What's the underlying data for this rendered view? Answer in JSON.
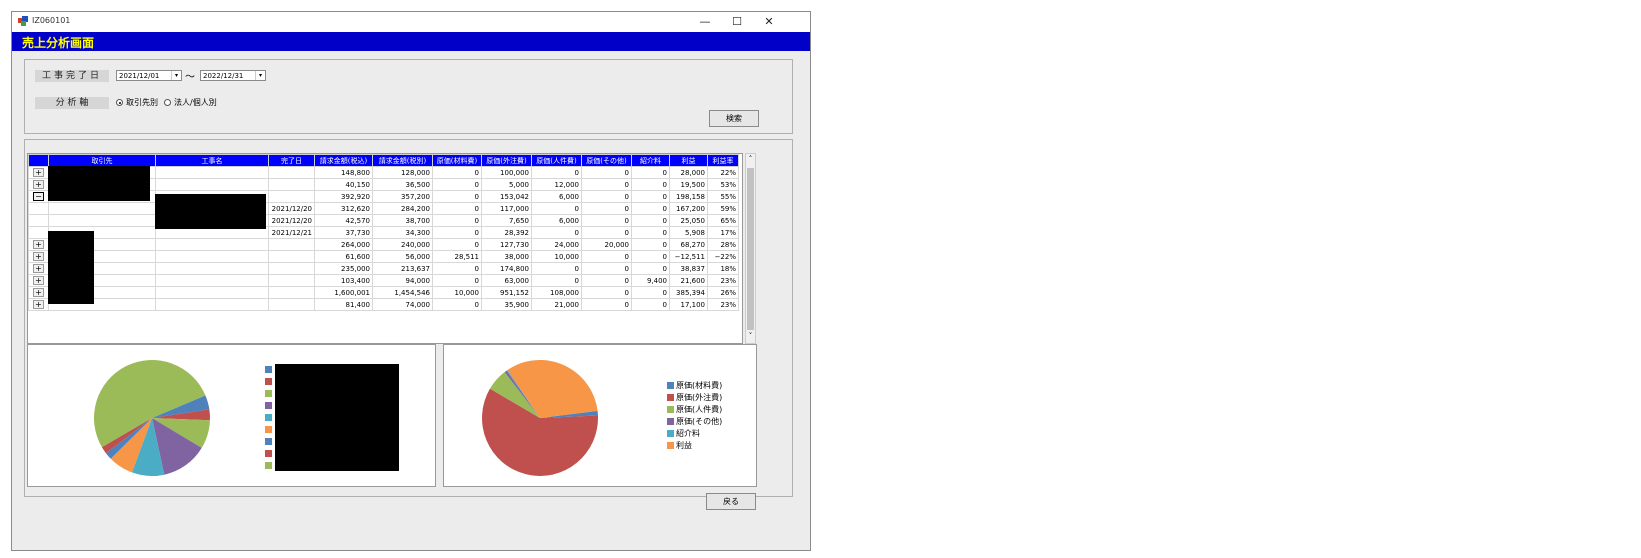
{
  "window": {
    "title": "IZ060101",
    "minimize": "—",
    "maximize": "☐",
    "close": "✕"
  },
  "banner": {
    "title": "売上分析画面"
  },
  "criteria": {
    "date_label": "工事完了日",
    "date_from": "2021/12/01",
    "tilde": "～",
    "date_to": "2022/12/31",
    "axis_label": "分 析 軸",
    "radio1": "取引先別",
    "radio2": "法人/個人別",
    "radio_selected": "取引先別",
    "search_button": "検索"
  },
  "grid": {
    "columns": [
      "取引先",
      "工事名",
      "完了日",
      "請求金額(税込)",
      "請求金額(税別)",
      "原価(材料費)",
      "原価(外注費)",
      "原価(人件費)",
      "原価(その他)",
      "紹介料",
      "利益",
      "利益率"
    ],
    "rows": [
      {
        "expander": "+",
        "date": "",
        "values": [
          "148,800",
          "128,000",
          "0",
          "100,000",
          "0",
          "0",
          "0",
          "28,000",
          "22%"
        ]
      },
      {
        "expander": "+",
        "date": "",
        "values": [
          "40,150",
          "36,500",
          "0",
          "5,000",
          "12,000",
          "0",
          "0",
          "19,500",
          "53%"
        ]
      },
      {
        "expander": "−",
        "date": "",
        "values": [
          "392,920",
          "357,200",
          "0",
          "153,042",
          "6,000",
          "0",
          "0",
          "198,158",
          "55%"
        ]
      },
      {
        "expander": "",
        "date": "2021/12/20",
        "values": [
          "312,620",
          "284,200",
          "0",
          "117,000",
          "0",
          "0",
          "0",
          "167,200",
          "59%"
        ]
      },
      {
        "expander": "",
        "date": "2021/12/20",
        "values": [
          "42,570",
          "38,700",
          "0",
          "7,650",
          "6,000",
          "0",
          "0",
          "25,050",
          "65%"
        ]
      },
      {
        "expander": "",
        "date": "2021/12/21",
        "values": [
          "37,730",
          "34,300",
          "0",
          "28,392",
          "0",
          "0",
          "0",
          "5,908",
          "17%"
        ]
      },
      {
        "expander": "+",
        "date": "",
        "values": [
          "264,000",
          "240,000",
          "0",
          "127,730",
          "24,000",
          "20,000",
          "0",
          "68,270",
          "28%"
        ]
      },
      {
        "expander": "+",
        "date": "",
        "values": [
          "61,600",
          "56,000",
          "28,511",
          "38,000",
          "10,000",
          "0",
          "0",
          "−12,511",
          "−22%"
        ]
      },
      {
        "expander": "+",
        "date": "",
        "values": [
          "235,000",
          "213,637",
          "0",
          "174,800",
          "0",
          "0",
          "0",
          "38,837",
          "18%"
        ]
      },
      {
        "expander": "+",
        "date": "",
        "values": [
          "103,400",
          "94,000",
          "0",
          "63,000",
          "0",
          "0",
          "9,400",
          "21,600",
          "23%"
        ]
      },
      {
        "expander": "+",
        "date": "",
        "values": [
          "1,600,001",
          "1,454,546",
          "10,000",
          "951,152",
          "108,000",
          "0",
          "0",
          "385,394",
          "26%"
        ]
      },
      {
        "expander": "+",
        "date": "",
        "values": [
          "81,400",
          "74,000",
          "0",
          "35,900",
          "21,000",
          "0",
          "0",
          "17,100",
          "23%"
        ]
      }
    ],
    "scroll_up": "˄",
    "scroll_down": "˅"
  },
  "chart_left": {
    "type": "pie",
    "series": [
      {
        "value": 4,
        "color": "#4f81bd"
      },
      {
        "value": 3,
        "color": "#c0504d"
      },
      {
        "value": 8,
        "color": "#9bbb59"
      },
      {
        "value": 13,
        "color": "#8064a2"
      },
      {
        "value": 9,
        "color": "#4bacc6"
      },
      {
        "value": 7,
        "color": "#f79646"
      },
      {
        "value": 2,
        "color": "#4f81bd"
      },
      {
        "value": 2,
        "color": "#c0504d"
      },
      {
        "value": 52,
        "color": "#9bbb59"
      }
    ],
    "legend_colors": [
      "#4f81bd",
      "#c0504d",
      "#9bbb59",
      "#8064a2",
      "#4bacc6",
      "#f79646",
      "#4f81bd",
      "#c0504d",
      "#9bbb59"
    ]
  },
  "chart_right": {
    "type": "pie",
    "labels": [
      "原価(材料費)",
      "原価(外注費)",
      "原価(人件費)",
      "原価(その他)",
      "紹介料",
      "利益"
    ],
    "values": [
      38511,
      1801360,
      187000,
      20000,
      9400,
      990957
    ],
    "colors": [
      "#4f81bd",
      "#c0504d",
      "#9bbb59",
      "#8064a2",
      "#4bacc6",
      "#f79646"
    ]
  },
  "back_button": "戻る"
}
